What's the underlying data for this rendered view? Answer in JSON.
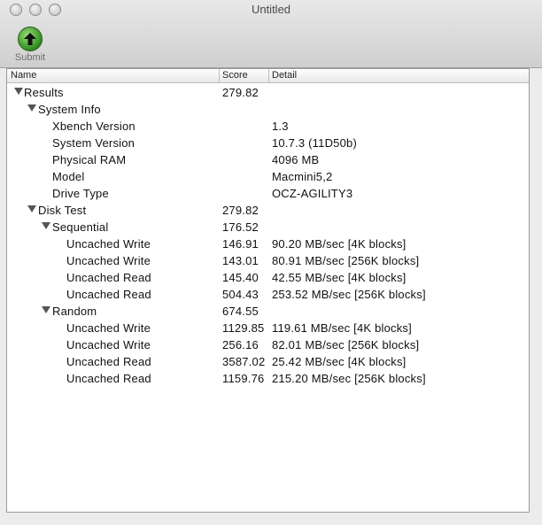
{
  "window": {
    "title": "Untitled"
  },
  "toolbar": {
    "submit_label": "Submit"
  },
  "columns": {
    "name": "Name",
    "score": "Score",
    "detail": "Detail"
  },
  "rows": [
    {
      "name": "Results",
      "score": "279.82",
      "detail": "",
      "expandable": true
    },
    {
      "name": "System Info",
      "score": "",
      "detail": "",
      "expandable": true
    },
    {
      "name": "Xbench Version",
      "score": "",
      "detail": "1.3"
    },
    {
      "name": "System Version",
      "score": "",
      "detail": "10.7.3 (11D50b)"
    },
    {
      "name": "Physical RAM",
      "score": "",
      "detail": "4096 MB"
    },
    {
      "name": "Model",
      "score": "",
      "detail": "Macmini5,2"
    },
    {
      "name": "Drive Type",
      "score": "",
      "detail": "OCZ-AGILITY3"
    },
    {
      "name": "Disk Test",
      "score": "279.82",
      "detail": "",
      "expandable": true
    },
    {
      "name": "Sequential",
      "score": "176.52",
      "detail": "",
      "expandable": true
    },
    {
      "name": "Uncached Write",
      "score": "146.91",
      "detail": "90.20 MB/sec [4K blocks]"
    },
    {
      "name": "Uncached Write",
      "score": "143.01",
      "detail": "80.91 MB/sec [256K blocks]"
    },
    {
      "name": "Uncached Read",
      "score": "145.40",
      "detail": "42.55 MB/sec [4K blocks]"
    },
    {
      "name": "Uncached Read",
      "score": "504.43",
      "detail": "253.52 MB/sec [256K blocks]"
    },
    {
      "name": "Random",
      "score": "674.55",
      "detail": "",
      "expandable": true
    },
    {
      "name": "Uncached Write",
      "score": "1129.85",
      "detail": "119.61 MB/sec [4K blocks]"
    },
    {
      "name": "Uncached Write",
      "score": "256.16",
      "detail": "82.01 MB/sec [256K blocks]"
    },
    {
      "name": "Uncached Read",
      "score": "3587.02",
      "detail": "25.42 MB/sec [4K blocks]"
    },
    {
      "name": "Uncached Read",
      "score": "1159.76",
      "detail": "215.20 MB/sec [256K blocks]"
    }
  ]
}
